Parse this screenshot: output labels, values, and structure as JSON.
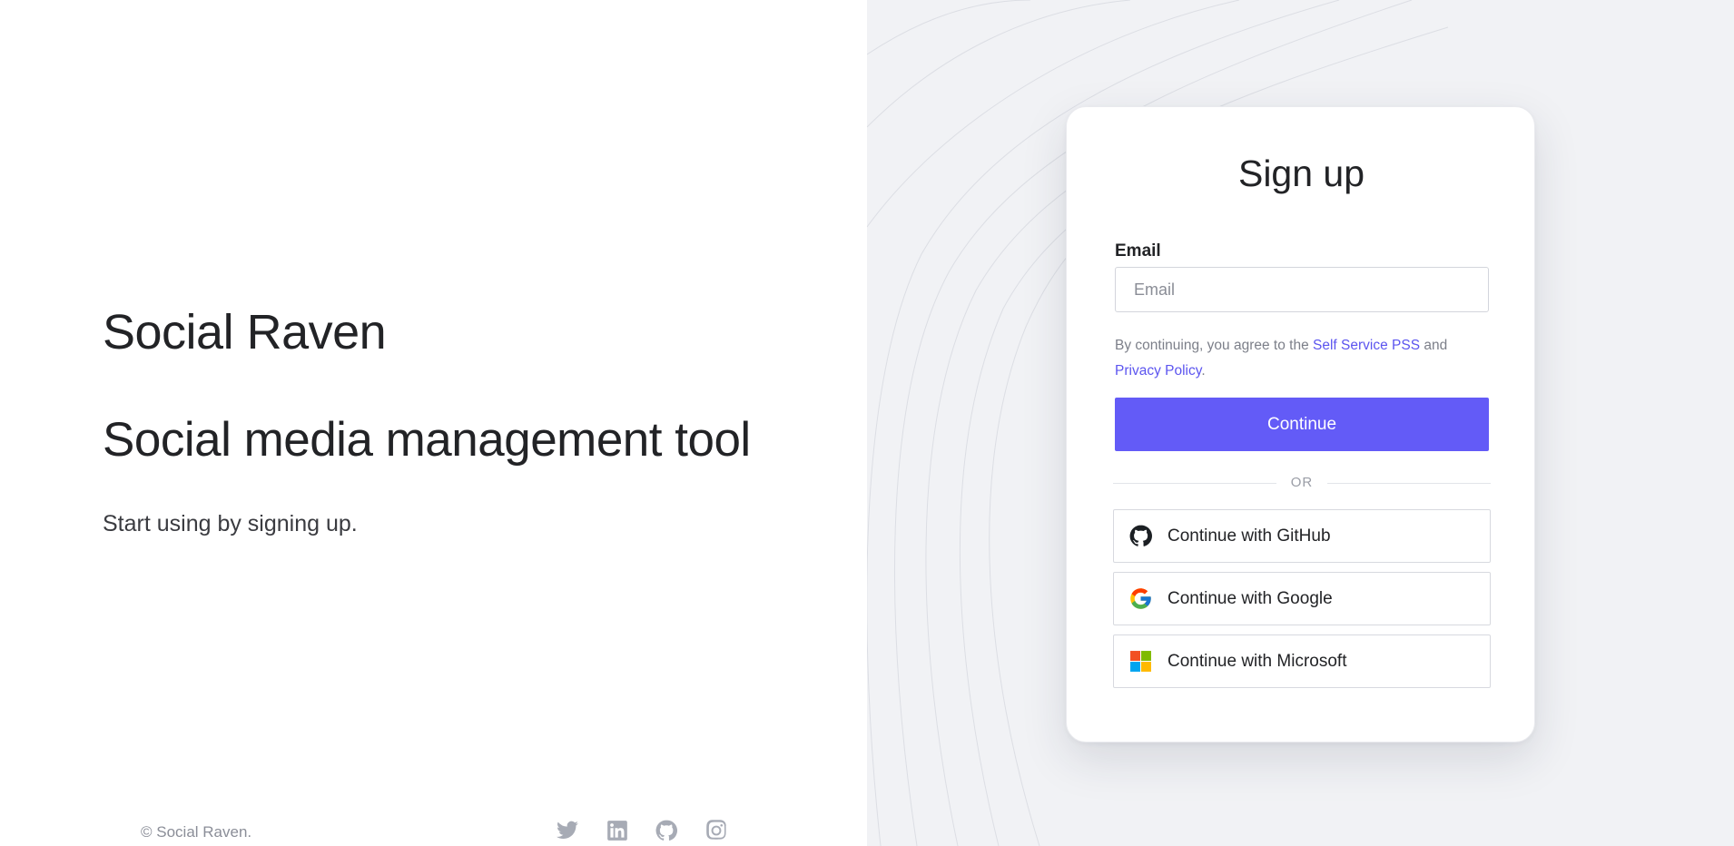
{
  "left": {
    "brand": "Social Raven",
    "tagline": "Social media management tool",
    "subtitle": "Start using by signing up.",
    "footer_copyright": "© Social Raven.",
    "social_icons": [
      "twitter-icon",
      "linkedin-icon",
      "github-icon",
      "instagram-icon"
    ]
  },
  "signup": {
    "title": "Sign up",
    "email_label": "Email",
    "email_placeholder": "Email",
    "email_value": "",
    "terms_prefix": "By continuing, you agree to the ",
    "terms_link": "Self Service PSS",
    "terms_middle": " and",
    "privacy_link": "Privacy Policy",
    "terms_suffix": ".",
    "continue_label": "Continue",
    "or_label": "OR",
    "github_label": "Continue with GitHub",
    "google_label": "Continue with Google",
    "microsoft_label": "Continue with Microsoft"
  },
  "colors": {
    "primary": "#635bf7",
    "link": "#5c55ef",
    "right_bg": "#f1f2f5"
  }
}
